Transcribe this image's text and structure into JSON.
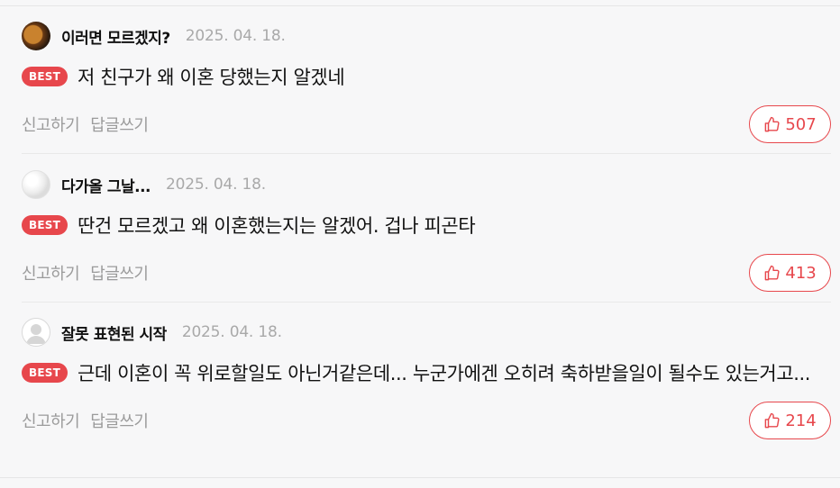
{
  "comments": [
    {
      "nickname": "이러면 모르겠지?",
      "date": "2025. 04. 18.",
      "badge": "BEST",
      "text": "저 친구가 왜 이혼 당했는지 알겠네",
      "report_label": "신고하기",
      "reply_label": "답글쓰기",
      "likes": "507",
      "avatar_icon": "profile-photo-icon"
    },
    {
      "nickname": "다가올 그날...",
      "date": "2025. 04. 18.",
      "badge": "BEST",
      "text": "딴건 모르겠고 왜 이혼했는지는 알겠어. 겁나 피곤타",
      "report_label": "신고하기",
      "reply_label": "답글쓰기",
      "likes": "413",
      "avatar_icon": "profile-photo-icon"
    },
    {
      "nickname": "잘못 표현된 시작",
      "date": "2025. 04. 18.",
      "badge": "BEST",
      "text": "근데 이혼이 꼭 위로할일도 아닌거같은데... 누군가에겐 오히려 축하받을일이 될수도 있는거고...",
      "report_label": "신고하기",
      "reply_label": "답글쓰기",
      "likes": "214",
      "avatar_icon": "default-user-icon"
    }
  ],
  "colors": {
    "accent": "#e7474c",
    "muted": "#9b9b9b",
    "date": "#a9a9a9",
    "background": "#f7f7f8"
  },
  "icons": {
    "like": "thumbs-up-icon"
  }
}
